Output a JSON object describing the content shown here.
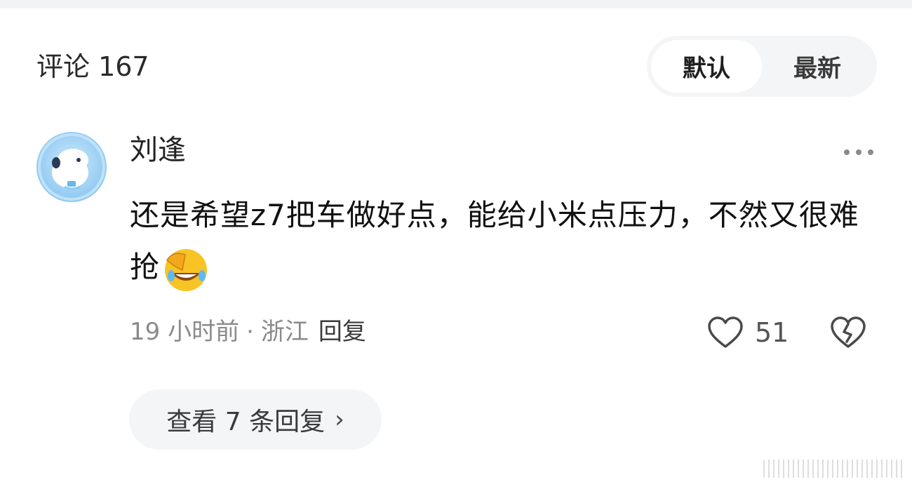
{
  "header": {
    "title": "评论 167",
    "sort_options": [
      "默认",
      "最新"
    ],
    "selected": "默认"
  },
  "comment": {
    "username": "刘逢",
    "text": "还是希望z7把车做好点，能给小米点压力，不然又很难抢",
    "emoji_icon": "facepalm-laughing-emoji",
    "time": "19 小时前",
    "separator": "·",
    "location": "浙江",
    "reply_label": "回复",
    "likes": "51",
    "view_replies_label": "查看 7 条回复"
  },
  "icons": {
    "more": "more-dots-icon",
    "like": "heart-outline-icon",
    "dislike": "broken-heart-icon",
    "chevron": "chevron-right-icon"
  },
  "colors": {
    "background": "#ffffff",
    "pill_background": "#f4f5f7",
    "meta_text": "#8a8a8a"
  }
}
